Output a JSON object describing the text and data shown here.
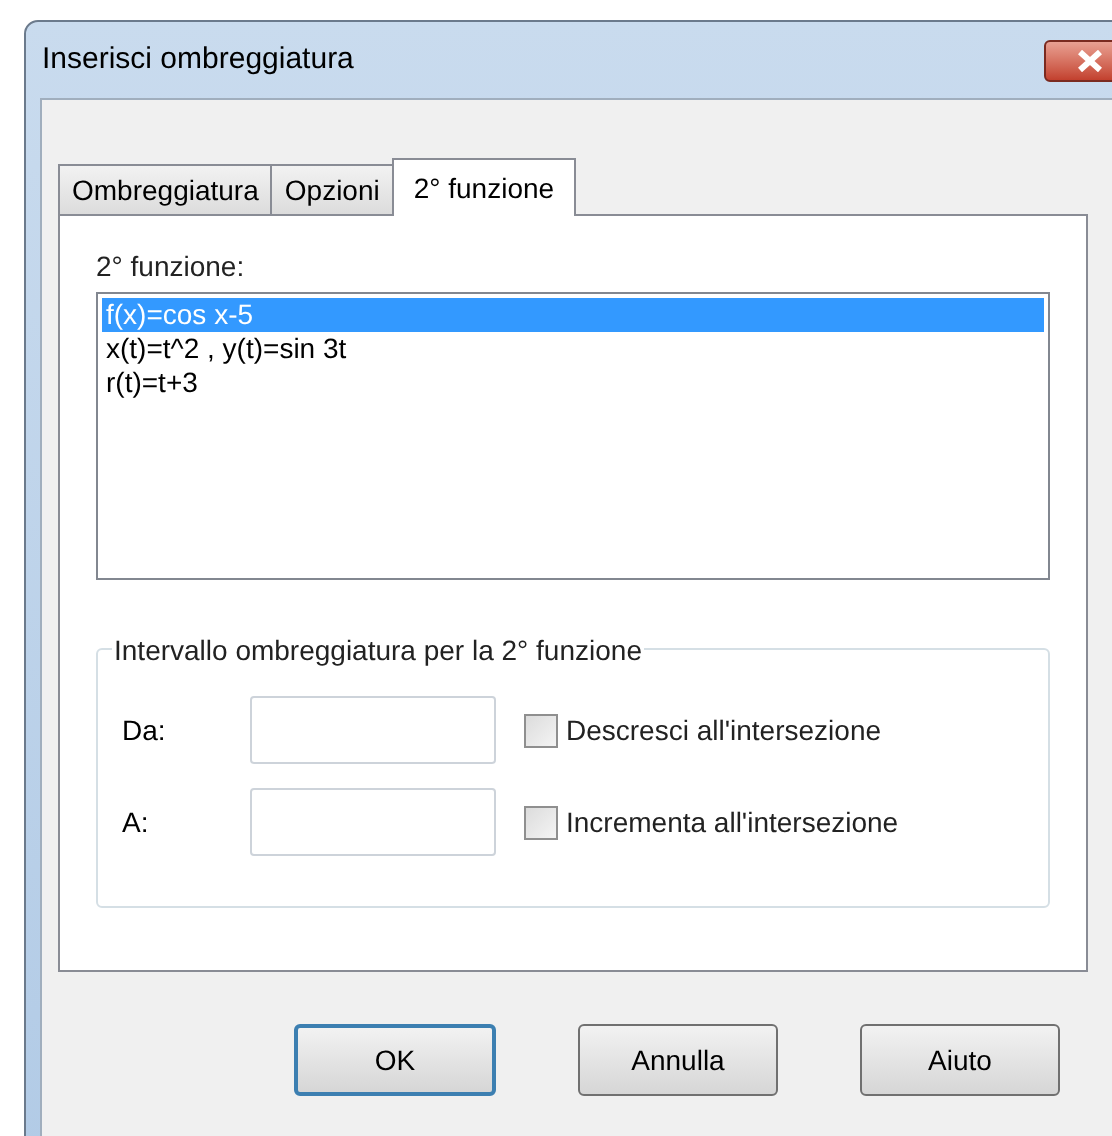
{
  "window": {
    "title": "Inserisci ombreggiatura"
  },
  "tabs": [
    {
      "label": "Ombreggiatura",
      "selected": false
    },
    {
      "label": "Opzioni",
      "selected": false
    },
    {
      "label": "2° funzione",
      "selected": true
    }
  ],
  "function_list": {
    "label": "2° funzione:",
    "items": [
      {
        "text": "f(x)=cos x-5",
        "selected": true
      },
      {
        "text": "x(t)=t^2 , y(t)=sin 3t",
        "selected": false
      },
      {
        "text": "r(t)=t+3",
        "selected": false
      }
    ]
  },
  "interval_group": {
    "title": "Intervallo ombreggiatura per la 2° funzione",
    "rows": [
      {
        "label": "Da:",
        "checkbox": "Descresci all'intersezione",
        "checked": false
      },
      {
        "label": "A:",
        "checkbox": "Incrementa all'intersezione",
        "checked": false
      }
    ]
  },
  "buttons": [
    {
      "label": "OK",
      "default": true
    },
    {
      "label": "Annulla",
      "default": false
    },
    {
      "label": "Aiuto",
      "default": false
    }
  ]
}
